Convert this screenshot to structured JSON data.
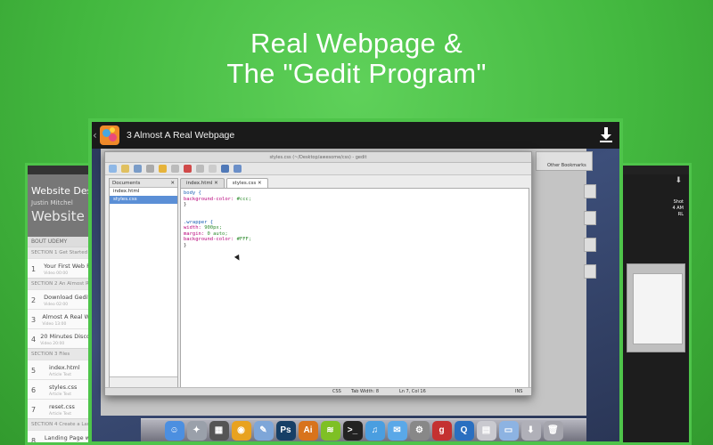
{
  "headline": {
    "line1": "Real Webpage &",
    "line2": "The \"Gedit Program\""
  },
  "main_card": {
    "title": "3  Almost A Real Webpage"
  },
  "left_card": {
    "header_title": "Website Desig",
    "author": "Justin Mitchel",
    "big_title": "Website de",
    "about": "BOUT UDEMY",
    "sections": [
      {
        "label": "SECTION 1  Get Started",
        "items": [
          {
            "num": "1",
            "title": "Your First Web P",
            "sub": "Video 00:00"
          }
        ]
      },
      {
        "label": "SECTION 2  An Almost Real W",
        "items": [
          {
            "num": "2",
            "title": "Download Gedit",
            "sub": "Video 02:00"
          },
          {
            "num": "3",
            "title": "Almost A Real W",
            "sub": "Video 13:00"
          },
          {
            "num": "4",
            "title": "20 Minutes Disco",
            "sub": "Video 20:00"
          }
        ]
      },
      {
        "label": "SECTION 3  Files",
        "items": [
          {
            "num": "5",
            "title": "index.html",
            "sub": "Article Text"
          },
          {
            "num": "6",
            "title": "styles.css",
            "sub": "Article Text"
          },
          {
            "num": "7",
            "title": "reset.css",
            "sub": "Article Text"
          }
        ]
      },
      {
        "label": "SECTION 4  Create a Landing",
        "items": [
          {
            "num": "8",
            "title": "Landing Page w",
            "sub": "Video 44:00"
          }
        ]
      }
    ]
  },
  "right_card": {
    "desktop_label": "Shot\n4 AM\nRL"
  },
  "gedit": {
    "window_title": "styles.css (~/Desktop/awesome/css) - gedit",
    "panel_title": "Documents",
    "files": [
      "index.html",
      "styles.css"
    ],
    "tabs": [
      "index.html",
      "styles.css"
    ],
    "code_lines": [
      [
        {
          "t": "body {",
          "c": "sel-tok"
        }
      ],
      [
        {
          "t": "background-color: ",
          "c": "prop"
        },
        {
          "t": "#ccc;",
          "c": "val"
        }
      ],
      [
        {
          "t": "}",
          "c": "brace"
        }
      ],
      [
        {
          "t": "",
          "c": "brace"
        }
      ],
      [
        {
          "t": "",
          "c": "brace"
        }
      ],
      [
        {
          "t": ".wrapper {",
          "c": "sel-tok"
        }
      ],
      [
        {
          "t": "width: ",
          "c": "prop"
        },
        {
          "t": "900px;",
          "c": "val"
        }
      ],
      [
        {
          "t": "margin: ",
          "c": "prop"
        },
        {
          "t": "0 auto;",
          "c": "val"
        }
      ],
      [
        {
          "t": "background-color: ",
          "c": "prop"
        },
        {
          "t": "#FFF;",
          "c": "val"
        }
      ],
      [
        {
          "t": "}",
          "c": "brace"
        }
      ]
    ],
    "status": {
      "lang": "CSS",
      "tab_width": "Tab Width:  8",
      "position": "Ln 7, Col 16",
      "mode": "INS"
    }
  },
  "browser": {
    "bookmarks": "Other Bookmarks"
  },
  "dock": [
    {
      "name": "finder-icon",
      "bg": "#4c8fe0",
      "glyph": "☺"
    },
    {
      "name": "launchpad-icon",
      "bg": "#9aa0aa",
      "glyph": "✦"
    },
    {
      "name": "calculator-icon",
      "bg": "#555",
      "glyph": "▦"
    },
    {
      "name": "chrome-icon",
      "bg": "#e8a21f",
      "glyph": "◉"
    },
    {
      "name": "preview-icon",
      "bg": "#7ea6d8",
      "glyph": "✎"
    },
    {
      "name": "photoshop-icon",
      "bg": "#163f66",
      "glyph": "Ps"
    },
    {
      "name": "illustrator-icon",
      "bg": "#d8731c",
      "glyph": "Ai"
    },
    {
      "name": "spotify-icon",
      "bg": "#7ec025",
      "glyph": "≋"
    },
    {
      "name": "terminal-icon",
      "bg": "#222",
      "glyph": ">_"
    },
    {
      "name": "itunes-icon",
      "bg": "#4a9ee0",
      "glyph": "♫"
    },
    {
      "name": "messages-icon",
      "bg": "#5aa8e8",
      "glyph": "✉"
    },
    {
      "name": "system-preferences-icon",
      "bg": "#888",
      "glyph": "⚙"
    },
    {
      "name": "gedit-icon",
      "bg": "#c43131",
      "glyph": "g"
    },
    {
      "name": "quicktime-icon",
      "bg": "#2a6fc0",
      "glyph": "Q"
    },
    {
      "name": "trash-icon",
      "bg": "#c9c9cf",
      "glyph": "▤"
    },
    {
      "name": "folder-icon",
      "bg": "#8db3e2",
      "glyph": "▭"
    },
    {
      "name": "downloads-icon",
      "bg": "#b0b0b8",
      "glyph": "⬇"
    },
    {
      "name": "bin-icon",
      "bg": "#a5a5ad",
      "glyph": "🗑"
    }
  ]
}
